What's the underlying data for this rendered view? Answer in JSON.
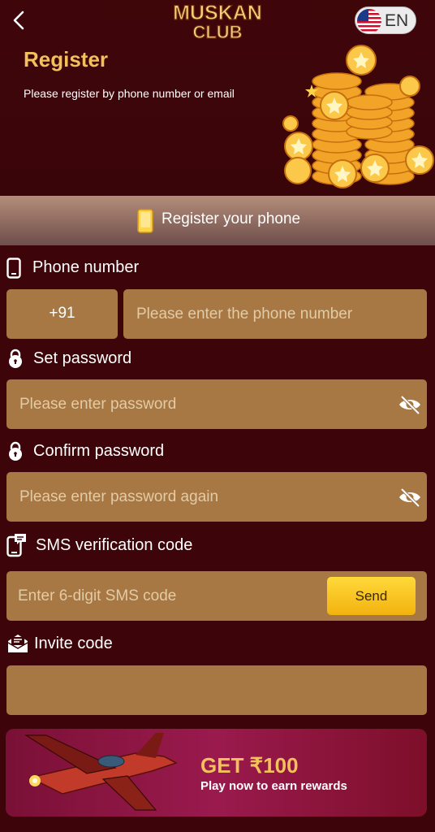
{
  "header": {
    "brand_line1": "MUSKAN",
    "brand_line2": "CLUB",
    "language": "EN",
    "title": "Register",
    "subtitle": "Please register by phone number or email"
  },
  "tab": {
    "label": "Register your phone",
    "icon": "smartphone-icon"
  },
  "form": {
    "phone": {
      "label": "Phone number",
      "country_code": "+91",
      "placeholder": "Please enter the phone number"
    },
    "password": {
      "label": "Set password",
      "placeholder": "Please enter password"
    },
    "confirm_password": {
      "label": "Confirm password",
      "placeholder": "Please enter password again"
    },
    "sms": {
      "label": "SMS verification code",
      "placeholder": "Enter 6-digit SMS code",
      "send_label": "Send"
    },
    "invite": {
      "label": "Invite code",
      "value": ""
    }
  },
  "promo": {
    "amount": "GET ₹100",
    "text": "Play now to earn rewards"
  },
  "colors": {
    "background": "#3d0509",
    "accent_gold": "#f2c15b",
    "field": "#a77744",
    "send_button": "#fbc823"
  }
}
